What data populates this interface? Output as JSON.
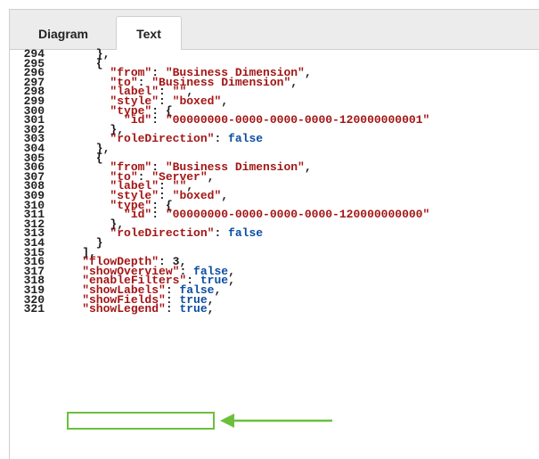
{
  "tabs": [
    {
      "label": "Diagram",
      "active": false
    },
    {
      "label": "Text",
      "active": true
    }
  ],
  "colors": {
    "string": "#a31515",
    "keyword": "#0b4ea2",
    "highlight": "#6cbf3c"
  },
  "lines": [
    {
      "n": "294",
      "tokens": [
        [
          "punc",
          "      },"
        ]
      ]
    },
    {
      "n": "295",
      "tokens": [
        [
          "punc",
          "      {"
        ]
      ]
    },
    {
      "n": "296",
      "tokens": [
        [
          "str",
          "        \"from\""
        ],
        [
          "punc",
          ": "
        ],
        [
          "str",
          "\"Business Dimension\""
        ],
        [
          "punc",
          ","
        ]
      ]
    },
    {
      "n": "297",
      "tokens": [
        [
          "str",
          "        \"to\""
        ],
        [
          "punc",
          ": "
        ],
        [
          "str",
          "\"Business Dimension\""
        ],
        [
          "punc",
          ","
        ]
      ]
    },
    {
      "n": "298",
      "tokens": [
        [
          "str",
          "        \"label\""
        ],
        [
          "punc",
          ": "
        ],
        [
          "str",
          "\"\""
        ],
        [
          "punc",
          ","
        ]
      ]
    },
    {
      "n": "299",
      "tokens": [
        [
          "str",
          "        \"style\""
        ],
        [
          "punc",
          ": "
        ],
        [
          "str",
          "\"boxed\""
        ],
        [
          "punc",
          ","
        ]
      ]
    },
    {
      "n": "300",
      "tokens": [
        [
          "str",
          "        \"type\""
        ],
        [
          "punc",
          ": {"
        ]
      ]
    },
    {
      "n": "301",
      "tokens": [
        [
          "str",
          "          \"id\""
        ],
        [
          "punc",
          ": "
        ],
        [
          "str",
          "\"00000000-0000-0000-0000-120000000001\""
        ]
      ]
    },
    {
      "n": "302",
      "tokens": [
        [
          "punc",
          "        },"
        ]
      ]
    },
    {
      "n": "303",
      "tokens": [
        [
          "str",
          "        \"roleDirection\""
        ],
        [
          "punc",
          ": "
        ],
        [
          "kw",
          "false"
        ]
      ]
    },
    {
      "n": "304",
      "tokens": [
        [
          "punc",
          "      },"
        ]
      ]
    },
    {
      "n": "305",
      "tokens": [
        [
          "punc",
          "      {"
        ]
      ]
    },
    {
      "n": "306",
      "tokens": [
        [
          "str",
          "        \"from\""
        ],
        [
          "punc",
          ": "
        ],
        [
          "str",
          "\"Business Dimension\""
        ],
        [
          "punc",
          ","
        ]
      ]
    },
    {
      "n": "307",
      "tokens": [
        [
          "str",
          "        \"to\""
        ],
        [
          "punc",
          ": "
        ],
        [
          "str",
          "\"Server\""
        ],
        [
          "punc",
          ","
        ]
      ]
    },
    {
      "n": "308",
      "tokens": [
        [
          "str",
          "        \"label\""
        ],
        [
          "punc",
          ": "
        ],
        [
          "str",
          "\"\""
        ],
        [
          "punc",
          ","
        ]
      ]
    },
    {
      "n": "309",
      "tokens": [
        [
          "str",
          "        \"style\""
        ],
        [
          "punc",
          ": "
        ],
        [
          "str",
          "\"boxed\""
        ],
        [
          "punc",
          ","
        ]
      ]
    },
    {
      "n": "310",
      "tokens": [
        [
          "str",
          "        \"type\""
        ],
        [
          "punc",
          ": {"
        ]
      ]
    },
    {
      "n": "311",
      "tokens": [
        [
          "str",
          "          \"id\""
        ],
        [
          "punc",
          ": "
        ],
        [
          "str",
          "\"00000000-0000-0000-0000-120000000000\""
        ]
      ]
    },
    {
      "n": "312",
      "tokens": [
        [
          "punc",
          "        },"
        ]
      ]
    },
    {
      "n": "313",
      "tokens": [
        [
          "str",
          "        \"roleDirection\""
        ],
        [
          "punc",
          ": "
        ],
        [
          "kw",
          "false"
        ]
      ]
    },
    {
      "n": "314",
      "tokens": [
        [
          "punc",
          "      }"
        ]
      ]
    },
    {
      "n": "315",
      "tokens": [
        [
          "punc",
          "    ],"
        ]
      ]
    },
    {
      "n": "316",
      "tokens": [
        [
          "str",
          "    \"flowDepth\""
        ],
        [
          "punc",
          ": "
        ],
        [
          "num",
          "3"
        ],
        [
          "punc",
          ","
        ]
      ]
    },
    {
      "n": "317",
      "tokens": [
        [
          "str",
          "    \"showOverview\""
        ],
        [
          "punc",
          ": "
        ],
        [
          "kw",
          "false"
        ],
        [
          "punc",
          ","
        ]
      ]
    },
    {
      "n": "318",
      "tokens": [
        [
          "str",
          "    \"enableFilters\""
        ],
        [
          "punc",
          ": "
        ],
        [
          "kw",
          "true"
        ],
        [
          "punc",
          ","
        ]
      ]
    },
    {
      "n": "319",
      "tokens": [
        [
          "str",
          "    \"showLabels\""
        ],
        [
          "punc",
          ": "
        ],
        [
          "kw",
          "false"
        ],
        [
          "punc",
          ","
        ]
      ]
    },
    {
      "n": "320",
      "tokens": [
        [
          "str",
          "    \"showFields\""
        ],
        [
          "punc",
          ": "
        ],
        [
          "kw",
          "true"
        ],
        [
          "punc",
          ","
        ]
      ]
    },
    {
      "n": "321",
      "tokens": [
        [
          "str",
          "    \"showLegend\""
        ],
        [
          "punc",
          ": "
        ],
        [
          "kw",
          "true"
        ],
        [
          "punc",
          ","
        ]
      ]
    }
  ]
}
